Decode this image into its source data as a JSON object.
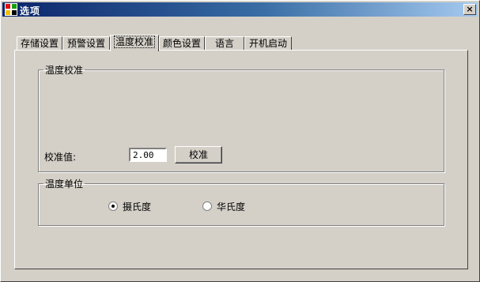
{
  "window": {
    "title": "选项",
    "close_label": "×"
  },
  "tabs": [
    {
      "label": "存储设置"
    },
    {
      "label": "预警设置"
    },
    {
      "label": "温度校准",
      "active": true
    },
    {
      "label": "颜色设置"
    },
    {
      "label": "语言"
    },
    {
      "label": "开机启动"
    }
  ],
  "calibration": {
    "group_title": "温度校准",
    "value_label": "校准值:",
    "value": "2.00",
    "button_label": "校准"
  },
  "units": {
    "group_title": "温度单位",
    "options": [
      {
        "label": "摄氏度",
        "checked": true
      },
      {
        "label": "华氏度",
        "checked": false
      }
    ]
  }
}
